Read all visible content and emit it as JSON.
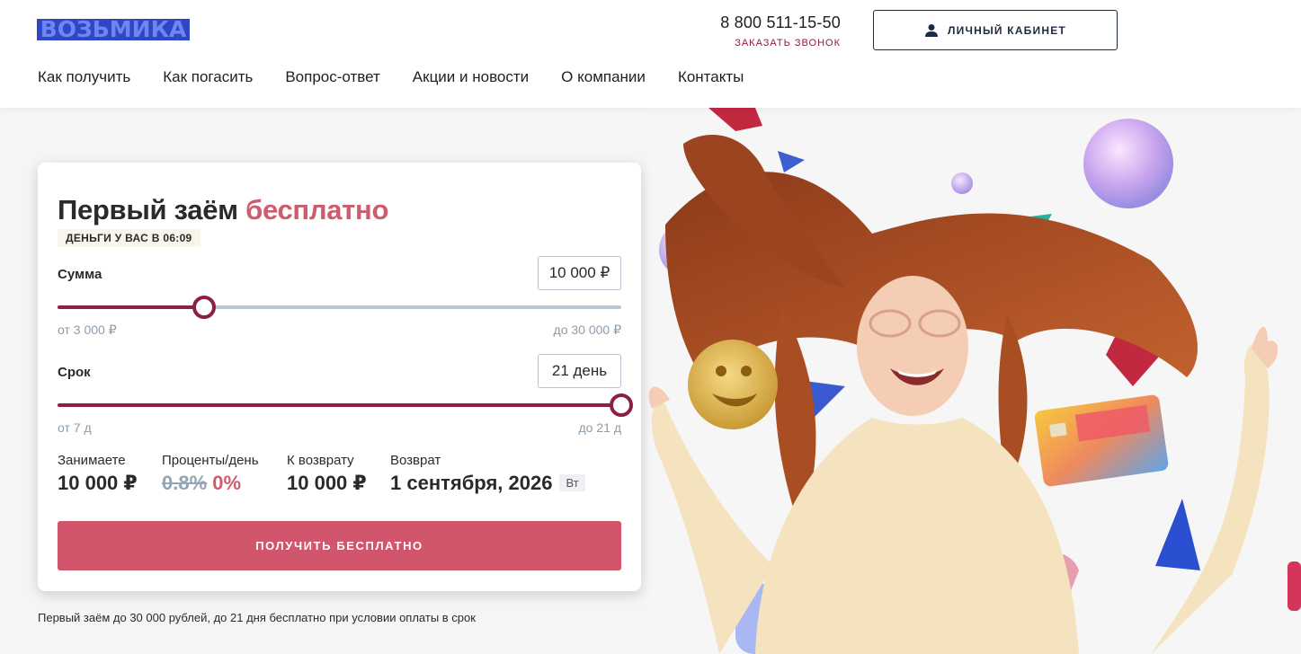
{
  "header": {
    "logo_text": "ВОЗЬМИКА",
    "phone": "8 800 511-15-50",
    "callback_label": "ЗАКАЗАТЬ ЗВОНОК",
    "cabinet_label": "ЛИЧНЫЙ КАБИНЕТ",
    "nav": [
      "Как получить",
      "Как погасить",
      "Вопрос-ответ",
      "Акции и новости",
      "О компании",
      "Контакты"
    ]
  },
  "calculator": {
    "title_main": "Первый заём ",
    "title_accent": "бесплатно",
    "badge": "ДЕНЬГИ У ВАС В 06:09",
    "amount": {
      "label": "Сумма",
      "value": "10 000 ₽",
      "min_label": "от 3 000 ₽",
      "max_label": "до 30 000 ₽",
      "min": 3000,
      "max": 30000,
      "current": 10000
    },
    "term": {
      "label": "Срок",
      "value": "21 день",
      "min_label": "от 7 д",
      "max_label": "до 21 д",
      "min": 7,
      "max": 21,
      "current": 21
    },
    "summary": {
      "borrow_label": "Занимаете",
      "borrow_value": "10 000 ₽",
      "rate_label": "Проценты/день",
      "rate_old": "0.8%",
      "rate_new": "0%",
      "return_label": "К возврату",
      "return_value": "10 000 ₽",
      "date_label": "Возврат",
      "date_value": "1 сентября, 2026",
      "weekday": "Вт"
    },
    "cta_label": "ПОЛУЧИТЬ БЕСПЛАТНО"
  },
  "footnote": "Первый заём до 30 000 рублей, до 21 дня бесплатно при условии оплаты в срок",
  "colors": {
    "accent": "#cf5b6d",
    "brand_dark": "#8b1f45",
    "logo_blue": "#2f46c6",
    "button": "#d1566c"
  },
  "icons": {
    "cabinet": "user-icon"
  }
}
